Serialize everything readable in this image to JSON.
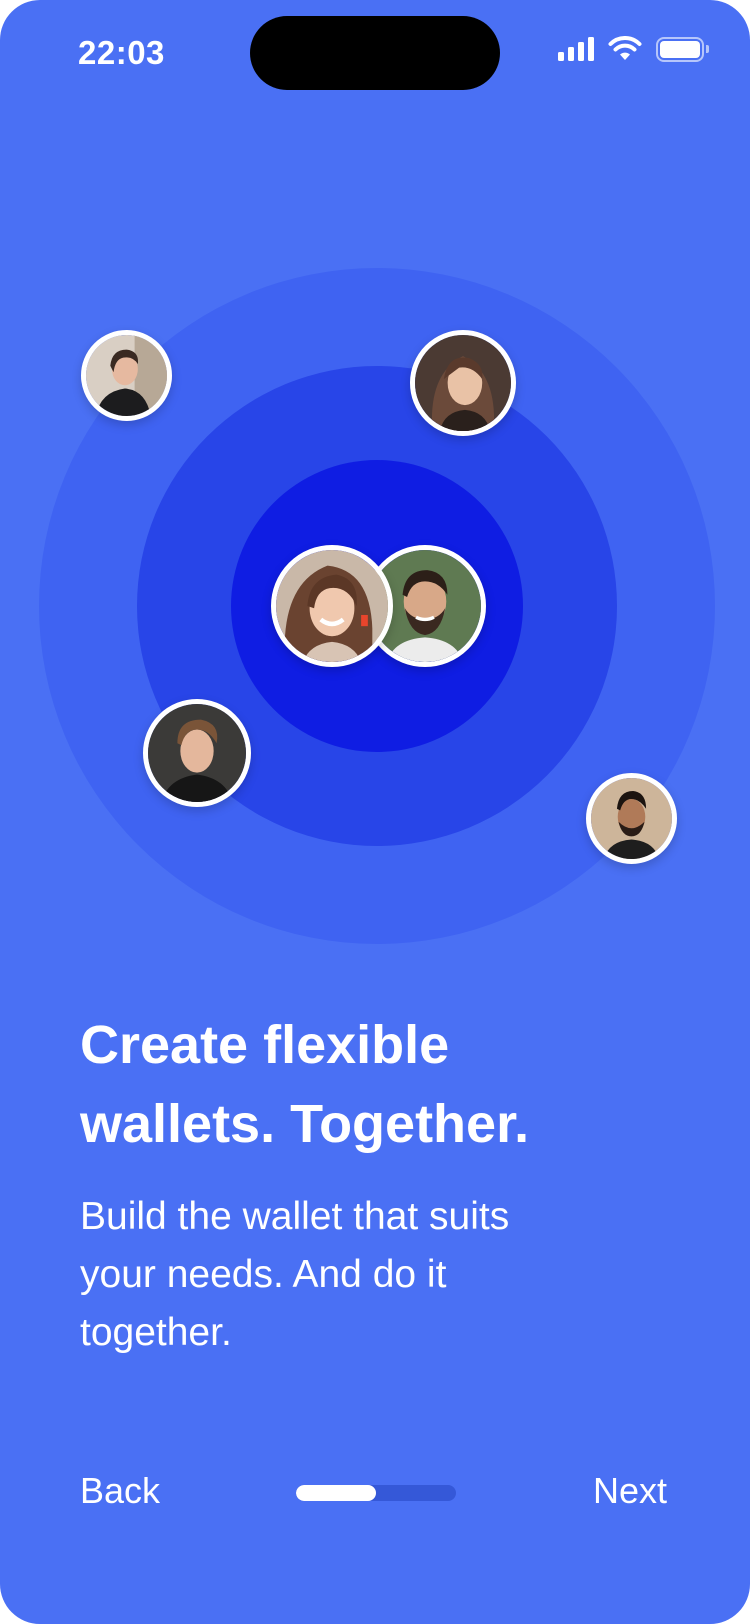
{
  "status_bar": {
    "time": "22:03",
    "icons": [
      "cellular-signal-icon",
      "wifi-icon",
      "battery-icon"
    ]
  },
  "illustration": {
    "avatars": [
      {
        "name": "avatar-woman-dark-hair-left",
        "icon": "person-avatar"
      },
      {
        "name": "avatar-woman-top-right",
        "icon": "person-avatar"
      },
      {
        "name": "avatar-woman-smiling-center",
        "icon": "person-avatar"
      },
      {
        "name": "avatar-man-beard-center",
        "icon": "person-avatar"
      },
      {
        "name": "avatar-young-man-left",
        "icon": "person-avatar"
      },
      {
        "name": "avatar-man-right",
        "icon": "person-avatar"
      }
    ]
  },
  "content": {
    "headline_line1": "Create flexible",
    "headline_line2": "wallets. Together.",
    "subtitle_line1": "Build the wallet that suits",
    "subtitle_line2": "your needs. And do it",
    "subtitle_line3": "together."
  },
  "navigation": {
    "back_label": "Back",
    "next_label": "Next",
    "progress": 0.5
  },
  "colors": {
    "background": "#4a70f4",
    "ring_outer": "#3f63f2",
    "ring_middle": "#2845e8",
    "ring_inner": "#0f1de3",
    "progress_track": "#3558d8",
    "text": "#ffffff"
  }
}
